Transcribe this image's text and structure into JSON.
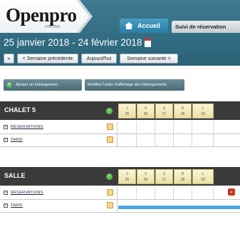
{
  "header": {
    "logo": "Openpro",
    "logo_sub": "ONLINE",
    "tabs": [
      {
        "label": "Accueil",
        "icon": "home-icon",
        "active": true
      },
      {
        "label": "Suivi de réservation"
      }
    ],
    "date_range": "25 janvier 2018 - 24 février 2018",
    "nav": {
      "first": "«",
      "prev": "< Semaine précédente",
      "today": "Aujourd'hui",
      "next": "Semaine suivante >"
    }
  },
  "toolbar": {
    "add_label": "Ajouter un hébergement",
    "modify_label": "Modifier l'ordre d'affichage des hébergements"
  },
  "grids": [
    {
      "title": "CHALET 5",
      "status": "ok",
      "days": [
        {
          "name": "J",
          "num": "25"
        },
        {
          "name": "V",
          "num": "26"
        },
        {
          "name": "S",
          "num": "27"
        },
        {
          "name": "D",
          "num": "28"
        },
        {
          "name": "L",
          "num": "29"
        }
      ],
      "rows": [
        {
          "label": "RÉSERVATIONS"
        },
        {
          "label": "TARIF"
        }
      ]
    },
    {
      "title": "SALLE",
      "status": "ok",
      "days": [
        {
          "name": "J",
          "num": "25"
        },
        {
          "name": "V",
          "num": "26"
        },
        {
          "name": "S",
          "num": "27"
        },
        {
          "name": "D",
          "num": "28"
        },
        {
          "name": "L",
          "num": "29"
        }
      ],
      "rows": [
        {
          "label": "RÉSERVATIONS"
        },
        {
          "label": "TARIF"
        }
      ]
    }
  ],
  "colors": {
    "header_bg": "#2f6a80",
    "tab_active": "#2a7ea6",
    "grid_header": "#3a3a3a",
    "status_ok": "#58c34a",
    "reservation_bar": "#4aa6e0",
    "reservation_marker": "#c8391f"
  }
}
